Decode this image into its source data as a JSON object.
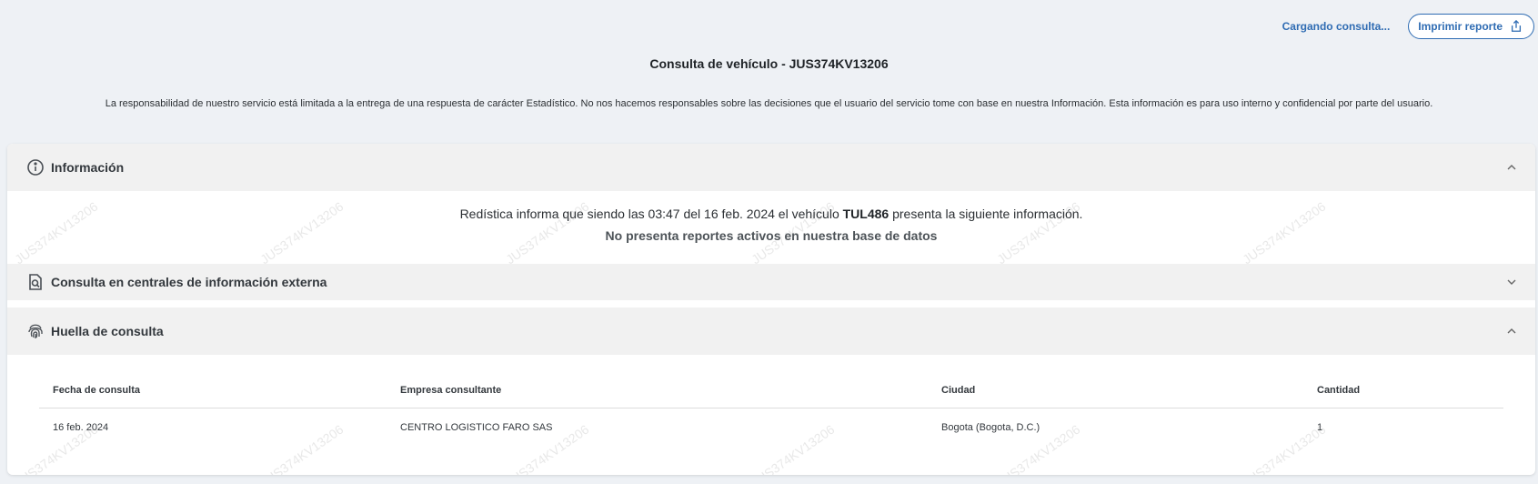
{
  "topbar": {
    "loading_text": "Cargando consulta...",
    "print_label": "Imprimir reporte",
    "print_icon": "share-icon"
  },
  "page": {
    "title": "Consulta de vehículo - JUS374KV13206",
    "disclaimer": "La responsabilidad de nuestro servicio está limitada a la entrega de una respuesta de carácter Estadístico. No nos hacemos responsables sobre las decisiones que el usuario del servicio tome con base en nuestra Información. Esta información es para uso interno y confidencial por parte del usuario."
  },
  "sections": {
    "informacion": {
      "title": "Información",
      "icon": "info-circle-icon",
      "expanded": true,
      "line1_prefix": "Redística informa que siendo las 03:47 del 16 feb. 2024 el vehículo ",
      "plate": "TUL486",
      "line1_suffix": " presenta la siguiente información.",
      "line2": "No presenta reportes activos en nuestra base de datos"
    },
    "externa": {
      "title": "Consulta en centrales de información externa",
      "icon": "document-search-icon",
      "expanded": false
    },
    "huella": {
      "title": "Huella de consulta",
      "icon": "fingerprint-icon",
      "expanded": true,
      "columns": [
        "Fecha de consulta",
        "Empresa consultante",
        "Ciudad",
        "Cantidad"
      ],
      "rows": [
        [
          "16 feb. 2024",
          "CENTRO LOGISTICO FARO SAS",
          "Bogota (Bogota, D.C.)",
          "1"
        ]
      ]
    }
  },
  "watermark": "JUS374KV13206"
}
